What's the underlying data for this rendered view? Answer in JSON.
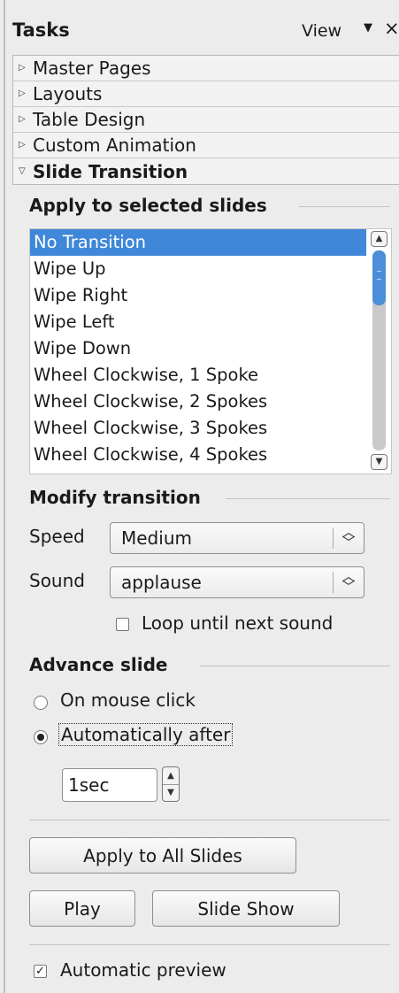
{
  "header": {
    "title": "Tasks",
    "view_label": "View",
    "close_glyph": "×"
  },
  "decks": [
    {
      "label": "Master Pages",
      "expanded": false
    },
    {
      "label": "Layouts",
      "expanded": false
    },
    {
      "label": "Table Design",
      "expanded": false
    },
    {
      "label": "Custom Animation",
      "expanded": false
    },
    {
      "label": "Slide Transition",
      "expanded": true
    }
  ],
  "apply_section": {
    "heading": "Apply to selected slides",
    "transitions": [
      "No Transition",
      "Wipe Up",
      "Wipe Right",
      "Wipe Left",
      "Wipe Down",
      "Wheel Clockwise, 1 Spoke",
      "Wheel Clockwise, 2 Spokes",
      "Wheel Clockwise, 3 Spokes",
      "Wheel Clockwise, 4 Spokes"
    ],
    "selected": "No Transition"
  },
  "modify_section": {
    "heading": "Modify transition",
    "speed_label": "Speed",
    "speed_value": "Medium",
    "sound_label": "Sound",
    "sound_value": "applause",
    "loop_label": "Loop until next sound",
    "loop_checked": false
  },
  "advance_section": {
    "heading": "Advance slide",
    "on_click_label": "On mouse click",
    "auto_label": "Automatically after",
    "selected_option": "Automatically after",
    "auto_value": "1sec"
  },
  "buttons": {
    "apply_all": "Apply to All Slides",
    "play": "Play",
    "slide_show": "Slide Show"
  },
  "preview": {
    "label": "Automatic preview",
    "checked": true
  },
  "colors": {
    "selection": "#3f87d8",
    "scroll_thumb": "#4b8fda",
    "panel_bg": "#ececec"
  }
}
